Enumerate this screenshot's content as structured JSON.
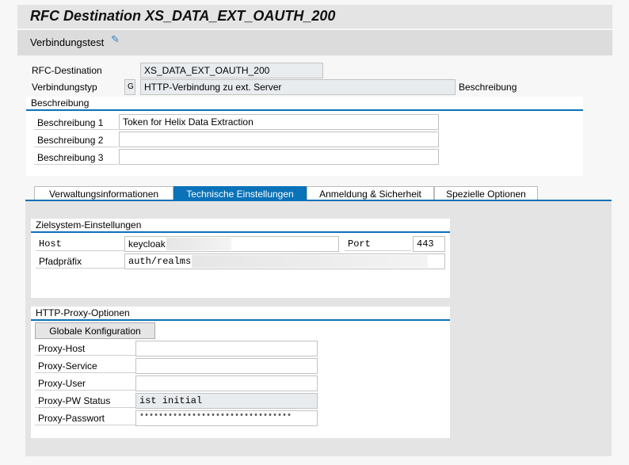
{
  "title": "RFC Destination XS_DATA_EXT_OAUTH_200",
  "toolbar": {
    "connection_test": "Verbindungstest",
    "icon": "glasses-pencil-icon"
  },
  "header": {
    "rfc_dest_label": "RFC-Destination",
    "rfc_dest_value": "XS_DATA_EXT_OAUTH_200",
    "conn_type_label": "Verbindungstyp",
    "conn_type_code": "G",
    "conn_type_value": "HTTP-Verbindung zu ext. Server",
    "desc_label": "Beschreibung"
  },
  "description": {
    "title": "Beschreibung",
    "rows": [
      {
        "label": "Beschreibung 1",
        "value": "Token for Helix Data Extraction"
      },
      {
        "label": "Beschreibung 2",
        "value": ""
      },
      {
        "label": "Beschreibung 3",
        "value": ""
      }
    ]
  },
  "tabs": [
    {
      "label": "Verwaltungsinformationen"
    },
    {
      "label": "Technische Einstellungen",
      "active": true
    },
    {
      "label": "Anmeldung & Sicherheit"
    },
    {
      "label": "Spezielle Optionen"
    }
  ],
  "target": {
    "title": "Zielsystem-Einstellungen",
    "host_label": "Host",
    "host_value": "keycloak",
    "port_label": "Port",
    "port_value": "443",
    "path_label": "Pfadpräfix",
    "path_value": "auth/realms/"
  },
  "proxy": {
    "title": "HTTP-Proxy-Optionen",
    "global_button": "Globale Konfiguration",
    "rows": [
      {
        "label": "Proxy-Host",
        "value": ""
      },
      {
        "label": "Proxy-Service",
        "value": ""
      },
      {
        "label": "Proxy-User",
        "value": ""
      },
      {
        "label": "Proxy-PW Status",
        "value": "ist initial"
      },
      {
        "label": "Proxy-Passwort",
        "value": "********************************"
      }
    ]
  },
  "colors": {
    "accent": "#0a72b8"
  }
}
